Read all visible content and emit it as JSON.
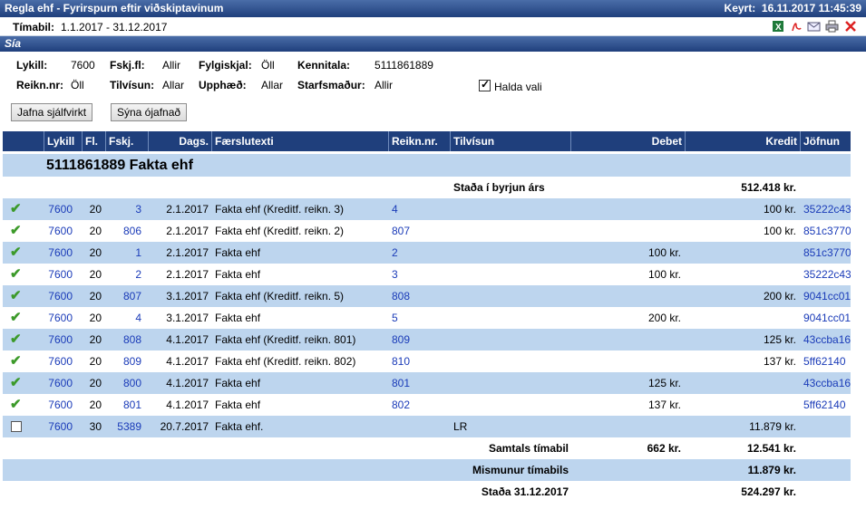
{
  "window": {
    "title": "Regla ehf - Fyrirspurn eftir viðskiptavinum",
    "run_label": "Keyrt:",
    "run_time": "16.11.2017 11:45:39"
  },
  "period": {
    "label": "Tímabil:",
    "value": "1.1.2017 - 31.12.2017"
  },
  "toolbar_icons": [
    "excel-icon",
    "pdf-icon",
    "mail-icon",
    "print-icon",
    "close-icon"
  ],
  "filter_panel": {
    "title": "Sía",
    "lykill": {
      "label": "Lykill:",
      "value": "7600"
    },
    "fskjfl": {
      "label": "Fskj.fl:",
      "value": "Allir"
    },
    "fylgiskjal": {
      "label": "Fylgiskjal:",
      "value": "Öll"
    },
    "kennitala": {
      "label": "Kennitala:",
      "value": "5111861889"
    },
    "reiknnr": {
      "label": "Reikn.nr:",
      "value": "Öll"
    },
    "tilvisun": {
      "label": "Tilvísun:",
      "value": "Allar"
    },
    "upphaed": {
      "label": "Upphæð:",
      "value": "Allar"
    },
    "starfsmadur": {
      "label": "Starfsmaður:",
      "value": "Allir"
    },
    "halda_vali": {
      "label": "Halda vali",
      "checked": true
    },
    "btn_jafna": "Jafna sjálfvirkt",
    "btn_syna": "Sýna ójafnað"
  },
  "columns": [
    "Lykill",
    "Fl.",
    "Fskj.",
    "Dags.",
    "Færslutexti",
    "Reikn.nr.",
    "Tilvísun",
    "Debet",
    "Kredit",
    "Jöfnun"
  ],
  "group": {
    "title": "5111861889 Fakta ehf"
  },
  "opening": {
    "label": "Staða í byrjun árs",
    "kredit": "512.418 kr."
  },
  "rows": [
    {
      "status": "matched",
      "lykill": "7600",
      "fl": "20",
      "fskj": "3",
      "dags": "2.1.2017",
      "texti": "Fakta ehf (Kreditf. reikn. 3)",
      "reikn": "4",
      "tilv": "",
      "debet": "",
      "kredit": "100 kr.",
      "jofnun": "35222c43"
    },
    {
      "status": "matched",
      "lykill": "7600",
      "fl": "20",
      "fskj": "806",
      "dags": "2.1.2017",
      "texti": "Fakta ehf (Kreditf. reikn. 2)",
      "reikn": "807",
      "tilv": "",
      "debet": "",
      "kredit": "100 kr.",
      "jofnun": "851c3770"
    },
    {
      "status": "matched",
      "lykill": "7600",
      "fl": "20",
      "fskj": "1",
      "dags": "2.1.2017",
      "texti": "Fakta ehf",
      "reikn": "2",
      "tilv": "",
      "debet": "100 kr.",
      "kredit": "",
      "jofnun": "851c3770"
    },
    {
      "status": "matched",
      "lykill": "7600",
      "fl": "20",
      "fskj": "2",
      "dags": "2.1.2017",
      "texti": "Fakta ehf",
      "reikn": "3",
      "tilv": "",
      "debet": "100 kr.",
      "kredit": "",
      "jofnun": "35222c43"
    },
    {
      "status": "matched",
      "lykill": "7600",
      "fl": "20",
      "fskj": "807",
      "dags": "3.1.2017",
      "texti": "Fakta ehf (Kreditf. reikn. 5)",
      "reikn": "808",
      "tilv": "",
      "debet": "",
      "kredit": "200 kr.",
      "jofnun": "9041cc01"
    },
    {
      "status": "matched",
      "lykill": "7600",
      "fl": "20",
      "fskj": "4",
      "dags": "3.1.2017",
      "texti": "Fakta ehf",
      "reikn": "5",
      "tilv": "",
      "debet": "200 kr.",
      "kredit": "",
      "jofnun": "9041cc01"
    },
    {
      "status": "matched",
      "lykill": "7600",
      "fl": "20",
      "fskj": "808",
      "dags": "4.1.2017",
      "texti": "Fakta ehf (Kreditf. reikn. 801)",
      "reikn": "809",
      "tilv": "",
      "debet": "",
      "kredit": "125 kr.",
      "jofnun": "43ccba16"
    },
    {
      "status": "matched",
      "lykill": "7600",
      "fl": "20",
      "fskj": "809",
      "dags": "4.1.2017",
      "texti": "Fakta ehf (Kreditf. reikn. 802)",
      "reikn": "810",
      "tilv": "",
      "debet": "",
      "kredit": "137 kr.",
      "jofnun": "5ff62140"
    },
    {
      "status": "matched",
      "lykill": "7600",
      "fl": "20",
      "fskj": "800",
      "dags": "4.1.2017",
      "texti": "Fakta ehf",
      "reikn": "801",
      "tilv": "",
      "debet": "125 kr.",
      "kredit": "",
      "jofnun": "43ccba16"
    },
    {
      "status": "matched",
      "lykill": "7600",
      "fl": "20",
      "fskj": "801",
      "dags": "4.1.2017",
      "texti": "Fakta ehf",
      "reikn": "802",
      "tilv": "",
      "debet": "137 kr.",
      "kredit": "",
      "jofnun": "5ff62140"
    },
    {
      "status": "open",
      "lykill": "7600",
      "fl": "30",
      "fskj": "5389",
      "dags": "20.7.2017",
      "texti": "Fakta ehf.",
      "reikn": "",
      "tilv": "LR",
      "debet": "",
      "kredit": "11.879 kr.",
      "jofnun": ""
    }
  ],
  "totals": {
    "label": "Samtals tímabil",
    "debet": "662 kr.",
    "kredit": "12.541 kr."
  },
  "difference": {
    "label": "Mismunur tímabils",
    "kredit": "11.879 kr."
  },
  "closing": {
    "label": "Staða 31.12.2017",
    "kredit": "524.297 kr."
  }
}
